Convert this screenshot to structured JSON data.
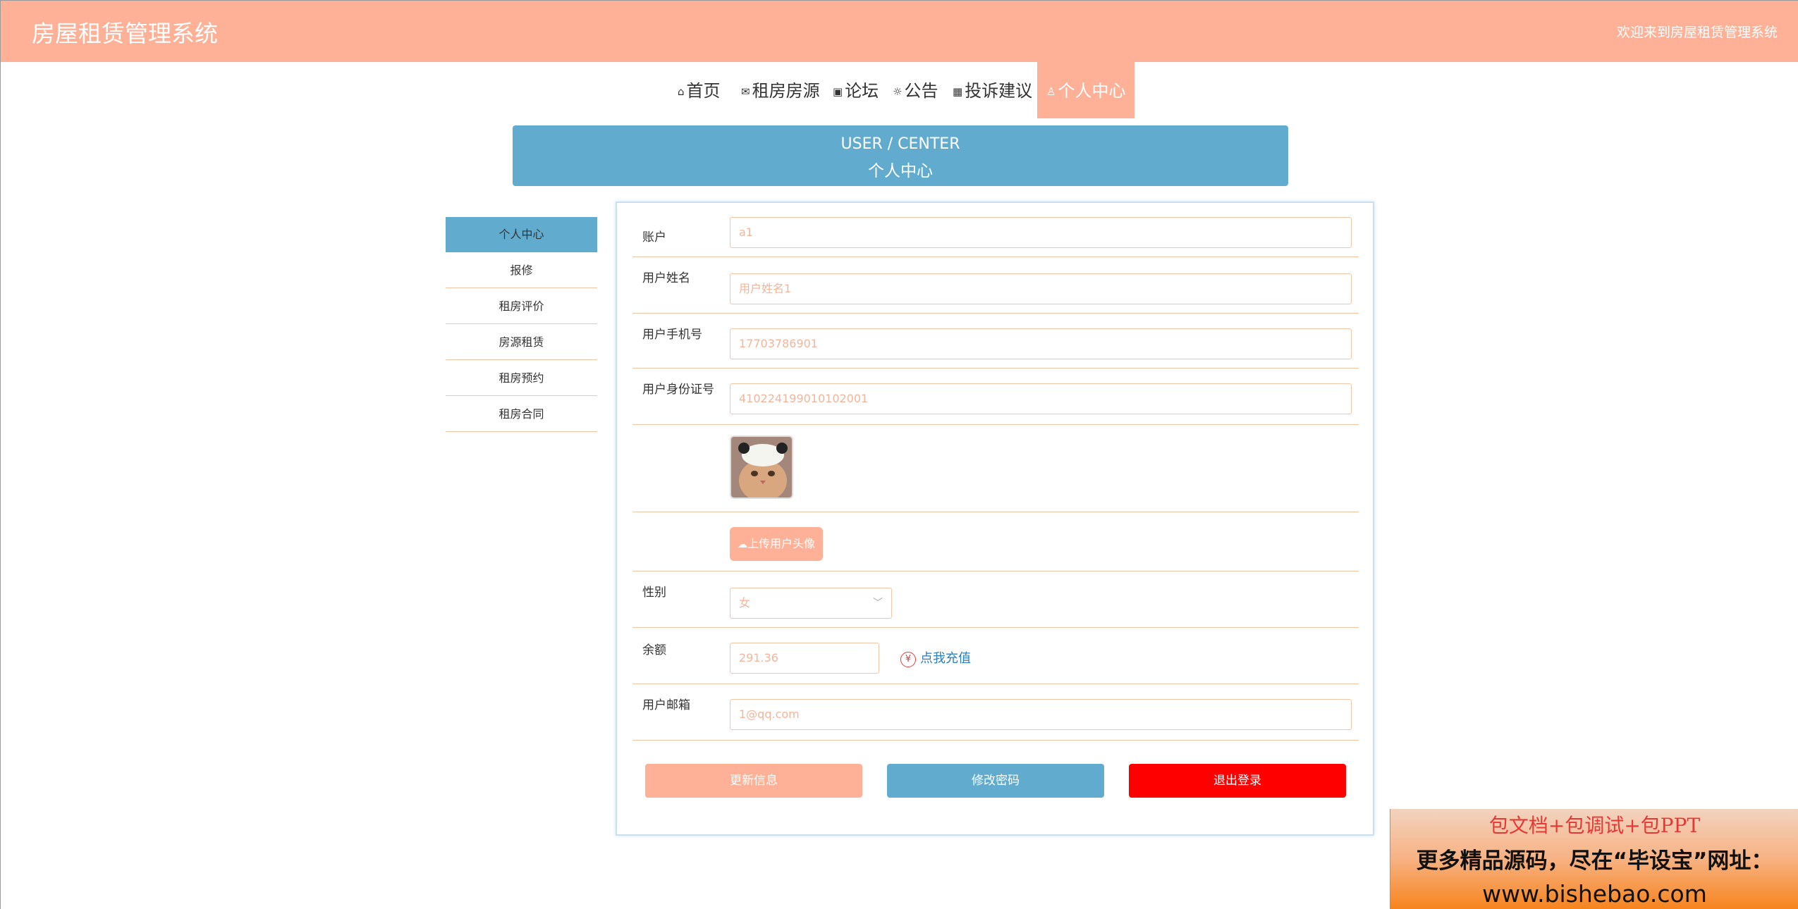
{
  "header": {
    "site_title": "房屋租赁管理系统",
    "welcome": "欢迎来到房屋租赁管理系统"
  },
  "nav": {
    "items": [
      {
        "icon": "home-icon",
        "label": "首页"
      },
      {
        "icon": "mail-icon",
        "label": "租房房源"
      },
      {
        "icon": "gift-icon",
        "label": "论坛"
      },
      {
        "icon": "sun-icon",
        "label": "公告"
      },
      {
        "icon": "grid-icon",
        "label": "投诉建议"
      },
      {
        "icon": "user-icon",
        "label": "个人中心"
      }
    ],
    "active": "个人中心"
  },
  "banner": {
    "title_en": "USER / CENTER",
    "title_cn": "个人中心"
  },
  "sidebar": {
    "items": [
      {
        "label": "个人中心"
      },
      {
        "label": "报修"
      },
      {
        "label": "租房评价"
      },
      {
        "label": "房源租赁"
      },
      {
        "label": "租房预约"
      },
      {
        "label": "租房合同"
      }
    ],
    "active": "个人中心"
  },
  "form": {
    "account": {
      "label": "账户",
      "value": "a1"
    },
    "user_name": {
      "label": "用户姓名",
      "value": "用户姓名1"
    },
    "phone": {
      "label": "用户手机号",
      "value": "17703786901"
    },
    "id_number": {
      "label": "用户身份证号",
      "value": "410224199010102001"
    },
    "upload_label": "上传用户头像",
    "gender": {
      "label": "性别",
      "value": "女"
    },
    "balance": {
      "label": "余额",
      "value": "291.36",
      "recharge": "点我充值"
    },
    "email": {
      "label": "用户邮箱",
      "value": "1@qq.com"
    }
  },
  "buttons": {
    "update": "更新信息",
    "change_password": "修改密码",
    "logout": "退出登录"
  },
  "colors": {
    "accent": "#ffb197",
    "blue": "#61acce",
    "danger": "#ff0000"
  },
  "promo": {
    "line1": "包文档+包调试+包PPT",
    "line2": "更多精品源码，尽在“毕设宝”网址：",
    "line3": "www.bishebao.com"
  }
}
